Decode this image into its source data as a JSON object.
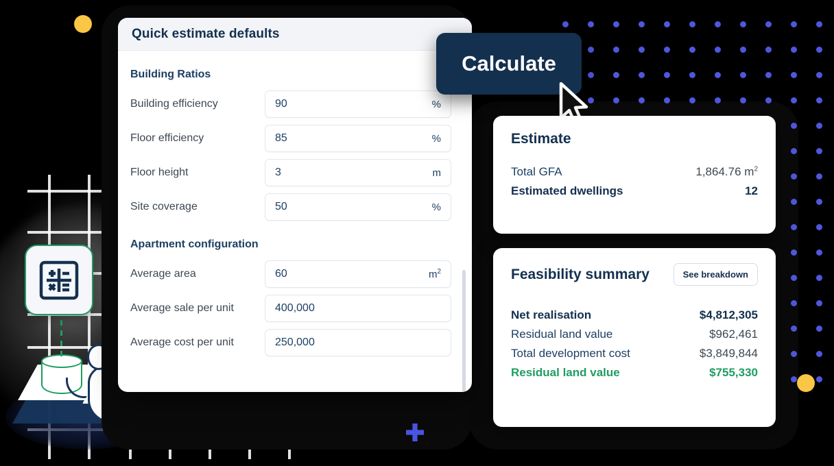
{
  "settings_panel": {
    "title": "Quick estimate defaults",
    "sections": [
      {
        "heading": "Building Ratios",
        "fields": [
          {
            "label": "Building efficiency",
            "value": "90",
            "unit": "%"
          },
          {
            "label": "Floor efficiency",
            "value": "85",
            "unit": "%"
          },
          {
            "label": "Floor height",
            "value": "3",
            "unit": "m"
          },
          {
            "label": "Site coverage",
            "value": "50",
            "unit": "%"
          }
        ]
      },
      {
        "heading": "Apartment configuration",
        "fields": [
          {
            "label": "Average area",
            "value": "60",
            "unit": "m",
            "unit_sup": "2"
          },
          {
            "label": "Average sale per unit",
            "value": "400,000",
            "unit": ""
          },
          {
            "label": "Average cost per unit",
            "value": "250,000",
            "unit": ""
          }
        ]
      }
    ]
  },
  "calculate_button": {
    "label": "Calculate"
  },
  "estimate_card": {
    "title": "Estimate",
    "rows": [
      {
        "key": "Total GFA",
        "value": "1,864.76 m",
        "value_sup": "2",
        "bold": false
      },
      {
        "key": "Estimated dwellings",
        "value": "12",
        "bold": true
      }
    ]
  },
  "feasibility_card": {
    "title": "Feasibility summary",
    "breakdown_button": "See breakdown",
    "rows": [
      {
        "key": "Net realisation",
        "value": "$4,812,305",
        "style": "bold"
      },
      {
        "key": "Residual land value",
        "value": "$962,461",
        "style": "normal"
      },
      {
        "key": "Total development cost",
        "value": "$3,849,844",
        "style": "normal"
      },
      {
        "key": "Residual land value",
        "value": "$755,330",
        "style": "green"
      }
    ]
  },
  "decor": {
    "yellow_dot": "#f9c646",
    "blue_dot": "#4f57dd",
    "accent_navy": "#14304f",
    "accent_green": "#1f9d62",
    "plus_icon": "plus-icon",
    "calculator_icon": "calculator-icon",
    "cursor_icon": "mouse-pointer-icon"
  }
}
